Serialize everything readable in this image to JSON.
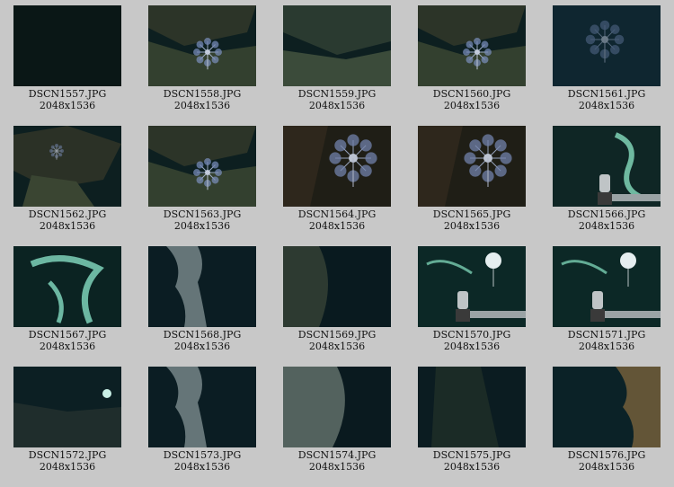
{
  "items": [
    {
      "filename": "DSCN1557.JPG",
      "dimensions": "2048x1536",
      "scene": "dark"
    },
    {
      "filename": "DSCN1558.JPG",
      "dimensions": "2048x1536",
      "scene": "organism_rock"
    },
    {
      "filename": "DSCN1559.JPG",
      "dimensions": "2048x1536",
      "scene": "rock"
    },
    {
      "filename": "DSCN1560.JPG",
      "dimensions": "2048x1536",
      "scene": "organism_rock"
    },
    {
      "filename": "DSCN1561.JPG",
      "dimensions": "2048x1536",
      "scene": "organism_blur"
    },
    {
      "filename": "DSCN1562.JPG",
      "dimensions": "2048x1536",
      "scene": "organism_small"
    },
    {
      "filename": "DSCN1563.JPG",
      "dimensions": "2048x1536",
      "scene": "organism_rock"
    },
    {
      "filename": "DSCN1564.JPG",
      "dimensions": "2048x1536",
      "scene": "organism_large"
    },
    {
      "filename": "DSCN1565.JPG",
      "dimensions": "2048x1536",
      "scene": "organism_large"
    },
    {
      "filename": "DSCN1566.JPG",
      "dimensions": "2048x1536",
      "scene": "green_growth_robot"
    },
    {
      "filename": "DSCN1567.JPG",
      "dimensions": "2048x1536",
      "scene": "green_growth"
    },
    {
      "filename": "DSCN1568.JPG",
      "dimensions": "2048x1536",
      "scene": "chimney"
    },
    {
      "filename": "DSCN1569.JPG",
      "dimensions": "2048x1536",
      "scene": "chimney_dark"
    },
    {
      "filename": "DSCN1570.JPG",
      "dimensions": "2048x1536",
      "scene": "marker_robot"
    },
    {
      "filename": "DSCN1571.JPG",
      "dimensions": "2048x1536",
      "scene": "marker_robot"
    },
    {
      "filename": "DSCN1572.JPG",
      "dimensions": "2048x1536",
      "scene": "seafloor_marker"
    },
    {
      "filename": "DSCN1573.JPG",
      "dimensions": "2048x1536",
      "scene": "chimney"
    },
    {
      "filename": "DSCN1574.JPG",
      "dimensions": "2048x1536",
      "scene": "chimney_left"
    },
    {
      "filename": "DSCN1575.JPG",
      "dimensions": "2048x1536",
      "scene": "dark_rock"
    },
    {
      "filename": "DSCN1576.JPG",
      "dimensions": "2048x1536",
      "scene": "rusty_chimney"
    }
  ],
  "colors": {
    "page_background": "#c8c8c8",
    "caption_text": "#111111"
  }
}
